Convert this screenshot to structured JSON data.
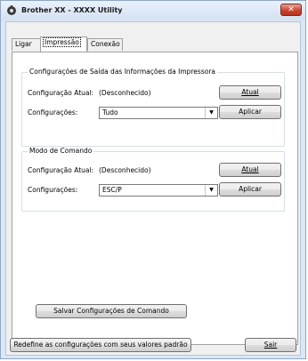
{
  "window": {
    "title": "Brother XX - XXXX Utility",
    "close_label": "✕"
  },
  "tabs": [
    {
      "label": "Ligar",
      "selected": false
    },
    {
      "label": "Impressão",
      "selected": true
    },
    {
      "label": "Conexão",
      "selected": false
    }
  ],
  "output_group": {
    "title": "Configurações de Saída das Informações da Impressora",
    "current_label": "Configuração Atual:",
    "current_value": "(Desconhecido)",
    "update_button": "Atual",
    "settings_label": "Configurações:",
    "settings_value": "Tudo",
    "apply_button": "Aplicar"
  },
  "command_group": {
    "title": "Modo de Comando",
    "current_label": "Configuração Atual:",
    "current_value": "(Desconhecido)",
    "update_button": "Atual",
    "settings_label": "Configurações:",
    "settings_value": "ESC/P",
    "apply_button": "Aplicar"
  },
  "save_button": "Salvar Configurações de Comando",
  "reset_button": "Redefine as configurações com seus valores padrão",
  "exit_button": "Sair",
  "icons": {
    "app": "printer-gear-icon",
    "dropdown": "chevron-down-icon",
    "close": "close-icon"
  }
}
